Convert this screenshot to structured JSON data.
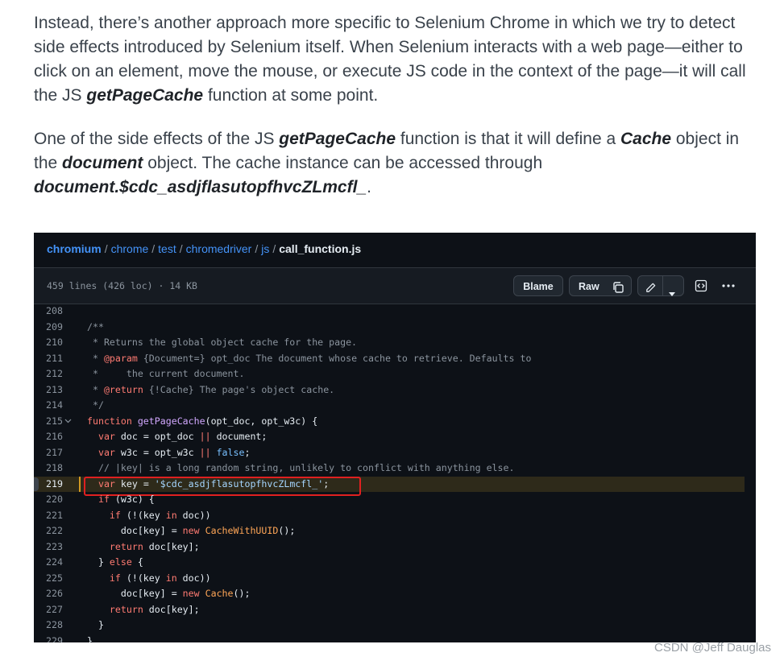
{
  "article": {
    "p1": [
      {
        "t": "Instead, there’s another approach more specific to Selenium Chrome in which we try to detect side effects introduced by Selenium itself. When Selenium interacts with a web page—either to click on an element, move the mouse, or execute JS code in the context of the page—it will call the JS ",
        "b": false
      },
      {
        "t": "getPageCache",
        "b": true
      },
      {
        "t": " function at some point.",
        "b": false
      }
    ],
    "p2": [
      {
        "t": "One of the side effects of the JS ",
        "b": false
      },
      {
        "t": "getPageCache",
        "b": true
      },
      {
        "t": " function is that it will define a ",
        "b": false
      },
      {
        "t": "Cache",
        "b": true
      },
      {
        "t": " object in the ",
        "b": false
      },
      {
        "t": "document",
        "b": true
      },
      {
        "t": " object. The cache instance can be accessed through ",
        "b": false
      },
      {
        "t": "document.$cdc_asdjflasutopfhvcZLmcfl_",
        "b": true
      },
      {
        "t": ".",
        "b": false
      }
    ]
  },
  "breadcrumb": {
    "parts": [
      "chromium",
      "chrome",
      "test",
      "chromedriver",
      "js"
    ],
    "separator": "/",
    "current": "call_function.js"
  },
  "file_meta": "459 lines (426 loc) · 14 KB",
  "toolbar": {
    "blame_label": "Blame",
    "raw_label": "Raw",
    "copy_icon": "copy-icon",
    "edit_icon": "pencil-icon",
    "dropdown_icon": "triangle-down-icon",
    "symbols_icon": "code-square-icon",
    "more_icon": "kebab-horizontal-icon"
  },
  "code": {
    "highlighted_line": 219,
    "lines": [
      {
        "n": 208,
        "fold": false,
        "tokens": []
      },
      {
        "n": 209,
        "fold": false,
        "tokens": [
          [
            "com",
            "/**"
          ]
        ]
      },
      {
        "n": 210,
        "fold": false,
        "tokens": [
          [
            "com",
            " * Returns the global object cache for the page."
          ]
        ]
      },
      {
        "n": 211,
        "fold": false,
        "tokens": [
          [
            "com",
            " * "
          ],
          [
            "kw",
            "@param"
          ],
          [
            "com",
            " {Document=} opt_doc The document whose cache to retrieve. Defaults to"
          ]
        ]
      },
      {
        "n": 212,
        "fold": false,
        "tokens": [
          [
            "com",
            " *     the current document."
          ]
        ]
      },
      {
        "n": 213,
        "fold": false,
        "tokens": [
          [
            "com",
            " * "
          ],
          [
            "kw",
            "@return"
          ],
          [
            "com",
            " {!Cache} The page's object cache."
          ]
        ]
      },
      {
        "n": 214,
        "fold": false,
        "tokens": [
          [
            "com",
            " */"
          ]
        ]
      },
      {
        "n": 215,
        "fold": true,
        "tokens": [
          [
            "kw",
            "function"
          ],
          [
            "p",
            " "
          ],
          [
            "fn",
            "getPageCache"
          ],
          [
            "p",
            "(opt_doc, opt_w3c) {"
          ]
        ]
      },
      {
        "n": 216,
        "fold": false,
        "tokens": [
          [
            "p",
            "  "
          ],
          [
            "kw",
            "var"
          ],
          [
            "p",
            " doc = opt_doc "
          ],
          [
            "kw",
            "||"
          ],
          [
            "p",
            " document;"
          ]
        ]
      },
      {
        "n": 217,
        "fold": false,
        "tokens": [
          [
            "p",
            "  "
          ],
          [
            "kw",
            "var"
          ],
          [
            "p",
            " w3c = opt_w3c "
          ],
          [
            "kw",
            "||"
          ],
          [
            "p",
            " "
          ],
          [
            "bool",
            "false"
          ],
          [
            "p",
            ";"
          ]
        ]
      },
      {
        "n": 218,
        "fold": false,
        "tokens": [
          [
            "com",
            "  // |key| is a long random string, unlikely to conflict with anything else."
          ]
        ]
      },
      {
        "n": 219,
        "fold": false,
        "tokens": [
          [
            "p",
            "  "
          ],
          [
            "kw",
            "var"
          ],
          [
            "p",
            " key = "
          ],
          [
            "str",
            "'$cdc_asdjflasutopfhvcZLmcfl_'"
          ],
          [
            "p",
            ";"
          ]
        ]
      },
      {
        "n": 220,
        "fold": false,
        "tokens": [
          [
            "p",
            "  "
          ],
          [
            "kw",
            "if"
          ],
          [
            "p",
            " (w3c) {"
          ]
        ]
      },
      {
        "n": 221,
        "fold": false,
        "tokens": [
          [
            "p",
            "    "
          ],
          [
            "kw",
            "if"
          ],
          [
            "p",
            " (!(key "
          ],
          [
            "kw",
            "in"
          ],
          [
            "p",
            " doc))"
          ]
        ]
      },
      {
        "n": 222,
        "fold": false,
        "tokens": [
          [
            "p",
            "      doc[key] = "
          ],
          [
            "kw",
            "new"
          ],
          [
            "p",
            " "
          ],
          [
            "cls",
            "CacheWithUUID"
          ],
          [
            "p",
            "();"
          ]
        ]
      },
      {
        "n": 223,
        "fold": false,
        "tokens": [
          [
            "p",
            "    "
          ],
          [
            "kw",
            "return"
          ],
          [
            "p",
            " doc[key];"
          ]
        ]
      },
      {
        "n": 224,
        "fold": false,
        "tokens": [
          [
            "p",
            "  } "
          ],
          [
            "kw",
            "else"
          ],
          [
            "p",
            " {"
          ]
        ]
      },
      {
        "n": 225,
        "fold": false,
        "tokens": [
          [
            "p",
            "    "
          ],
          [
            "kw",
            "if"
          ],
          [
            "p",
            " (!(key "
          ],
          [
            "kw",
            "in"
          ],
          [
            "p",
            " doc))"
          ]
        ]
      },
      {
        "n": 226,
        "fold": false,
        "tokens": [
          [
            "p",
            "      doc[key] = "
          ],
          [
            "kw",
            "new"
          ],
          [
            "p",
            " "
          ],
          [
            "cls",
            "Cache"
          ],
          [
            "p",
            "();"
          ]
        ]
      },
      {
        "n": 227,
        "fold": false,
        "tokens": [
          [
            "p",
            "    "
          ],
          [
            "kw",
            "return"
          ],
          [
            "p",
            " doc[key];"
          ]
        ]
      },
      {
        "n": 228,
        "fold": false,
        "tokens": [
          [
            "p",
            "  }"
          ]
        ]
      },
      {
        "n": 229,
        "fold": false,
        "tokens": [
          [
            "p",
            "}"
          ]
        ]
      }
    ]
  },
  "colors": {
    "code_bg": "#0d1117",
    "link": "#4493f8",
    "highlight_marker": "#d29922",
    "annotation_box": "#e02020"
  },
  "watermark": "CSDN @Jeff Dauglas"
}
